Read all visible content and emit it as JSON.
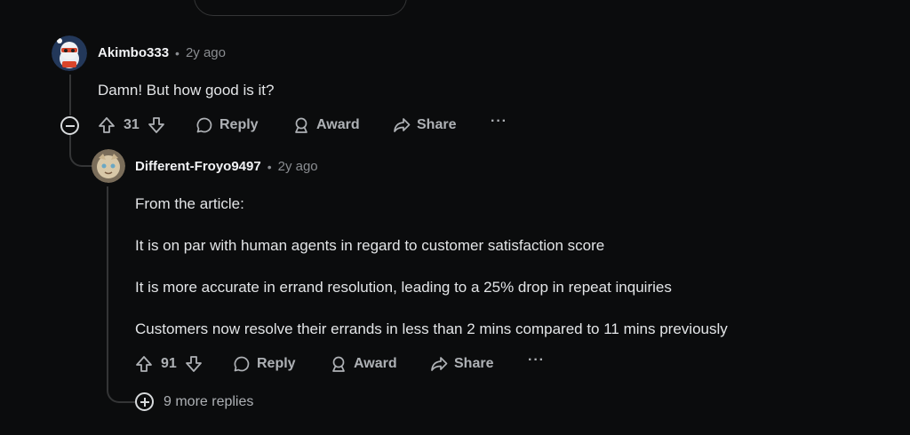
{
  "comment": {
    "username": "Akimbo333",
    "time": "2y ago",
    "body": "Damn! But how good is it?",
    "votes": "31",
    "actions": {
      "reply": "Reply",
      "award": "Award",
      "share": "Share",
      "more": "···"
    }
  },
  "reply": {
    "username": "Different-Froyo9497",
    "time": "2y ago",
    "paragraphs": [
      "From the article:",
      "It is on par with human agents in regard to customer satisfaction score",
      "It is more accurate in errand resolution, leading to a 25% drop in repeat inquiries",
      "Customers now resolve their errands in less than 2 mins compared to 11 mins previously"
    ],
    "votes": "91",
    "actions": {
      "reply": "Reply",
      "award": "Award",
      "share": "Share",
      "more": "···"
    },
    "more_replies": "9 more replies"
  },
  "colors": {
    "background": "#0b0c0d",
    "text": "#d7dadc",
    "muted": "#8a8d91",
    "thread_line": "#343536"
  }
}
